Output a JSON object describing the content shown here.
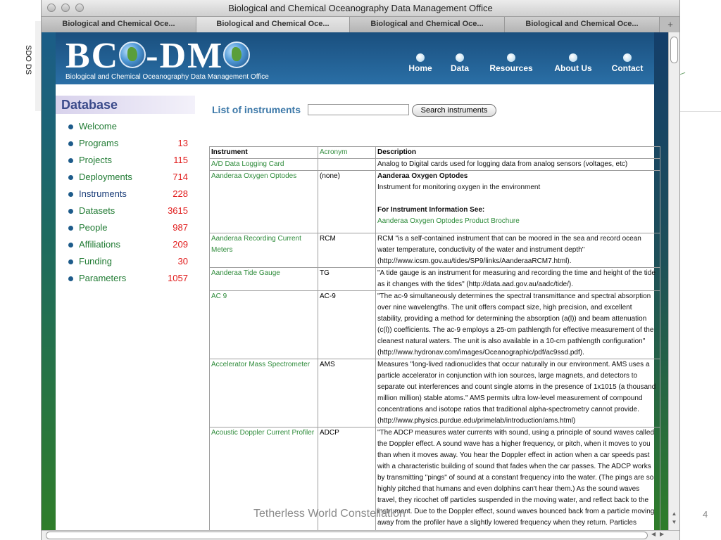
{
  "window": {
    "title": "Biological and Chemical Oceanography Data Management Office"
  },
  "tabs": [
    {
      "label": "Biological and Chemical Oce...",
      "active": false
    },
    {
      "label": "Biological and Chemical Oce...",
      "active": true
    },
    {
      "label": "Biological and Chemical Oce...",
      "active": false
    },
    {
      "label": "Biological and Chemical Oce...",
      "active": false
    }
  ],
  "header": {
    "logo_a": "BC",
    "logo_b": "-DM",
    "subtitle": "Biological and Chemical Oceanography Data Management Office",
    "nav": [
      "Home",
      "Data",
      "Resources",
      "About Us",
      "Contact"
    ]
  },
  "sidebar": {
    "title": "Database",
    "items": [
      {
        "label": "Welcome",
        "count": ""
      },
      {
        "label": "Programs",
        "count": "13"
      },
      {
        "label": "Projects",
        "count": "115"
      },
      {
        "label": "Deployments",
        "count": "714"
      },
      {
        "label": "Instruments",
        "count": "228"
      },
      {
        "label": "Datasets",
        "count": "3615"
      },
      {
        "label": "People",
        "count": "987"
      },
      {
        "label": "Affiliations",
        "count": "209"
      },
      {
        "label": "Funding",
        "count": "30"
      },
      {
        "label": "Parameters",
        "count": "1057"
      }
    ]
  },
  "search": {
    "title": "List of instruments",
    "value": "",
    "button": "Search instruments"
  },
  "table": {
    "headers": [
      "Instrument",
      "Acronym",
      "Description"
    ],
    "rows": [
      {
        "instrument": "A/D Data Logging Card",
        "acronym": "",
        "description": [
          "Analog to Digital cards used for logging data from analog sensors (voltages, etc)"
        ]
      },
      {
        "instrument": "Aanderaa Oxygen Optodes",
        "acronym": "(none)",
        "description": [
          "Aanderaa Oxygen Optodes",
          "Instrument for monitoring oxygen in the environment",
          "",
          "For Instrument Information See:",
          "Aanderaa Oxygen Optodes Product Brochure"
        ]
      },
      {
        "instrument": "Aanderaa Recording Current Meters",
        "acronym": "RCM",
        "description": [
          "RCM \"is a self-contained instrument that can be moored in the sea and record ocean water temperature, conductivity of the water and instrument depth\" (http://www.icsm.gov.au/tides/SP9/links/AanderaaRCM7.html)."
        ]
      },
      {
        "instrument": "Aanderaa Tide Gauge",
        "acronym": "TG",
        "description": [
          "\"A tide gauge is an instrument for measuring and recording the time and height of the tide as it changes with the tides\" (http://data.aad.gov.au/aadc/tide/)."
        ]
      },
      {
        "instrument": "AC 9",
        "acronym": "AC-9",
        "description": [
          "\"The ac-9 simultaneously determines the spectral transmittance and spectral absorption over nine wavelengths. The unit offers compact size, high precision, and excellent stability, providing a method for determining the absorption (a(l)) and beam attenuation (c(l)) coefficients. The ac-9 employs a 25-cm pathlength for effective measurement of the cleanest natural waters. The unit is also available in a 10-cm pathlength configuration\" (http://www.hydronav.com/images/Oceanographic/pdf/ac9ssd.pdf)."
        ]
      },
      {
        "instrument": "Accelerator Mass Spectrometer",
        "acronym": "AMS",
        "description": [
          "Measures \"long-lived radionuclides that occur naturally in our environment. AMS uses a particle accelerator in conjunction with ion sources, large magnets, and detectors to separate out interferences and count single atoms in the presence of 1x1015 (a thousand million million) stable atoms.\" AMS permits ultra low-level measurement of compound concentrations and isotope ratios that traditional alpha-spectrometry cannot provide. (http://www.physics.purdue.edu/primelab/introduction/ams.html)"
        ]
      },
      {
        "instrument": "Acoustic Doppler Current Profiler",
        "acronym": "ADCP",
        "description": [
          "\"The ADCP measures water currents with sound, using a principle of sound waves called the Doppler effect. A sound wave has a higher frequency, or pitch, when it moves to you than when it moves away. You hear the Doppler effect in action when a car speeds past with a characteristic building of sound that fades when the car passes. The ADCP works by transmitting \"pings\" of sound at a constant frequency into the water. (The pings are so highly pitched that humans and even dolphins can't hear them.) As the sound waves travel, they ricochet off particles suspended in the moving water, and reflect back to the instrument. Due to the Doppler effect, sound waves bounced back from a particle moving away from the profiler have a slightly lowered frequency when they return. Particles moving toward the instrument send back higher frequency"
        ]
      }
    ]
  },
  "slide": {
    "footer": "Tetherless World Constellation",
    "page_number": "4",
    "cutoff_text": "SDO DS"
  },
  "colors": {
    "accent_blue": "#3c78a8",
    "link_green": "#2e8b3a",
    "count_red": "#e11b1b",
    "header_blue": "#1a4f7e"
  }
}
